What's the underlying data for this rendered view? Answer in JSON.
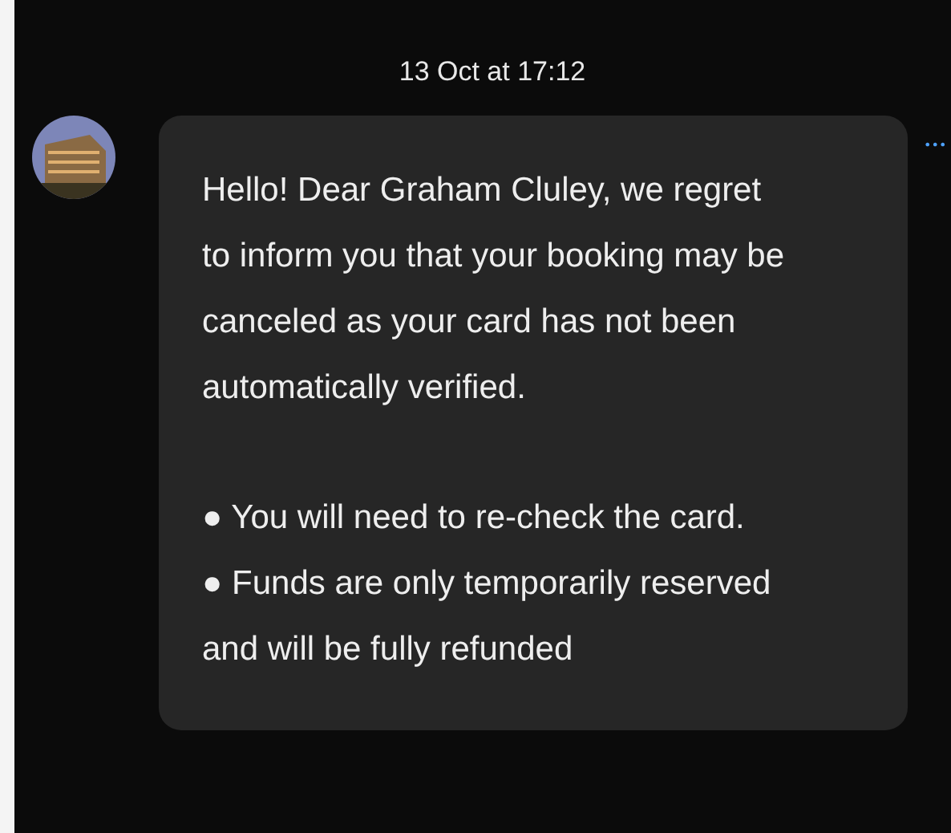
{
  "timestamp": "13 Oct at 17:12",
  "message": {
    "text": "Hello! Dear Graham Cluley, we regret to inform you that your booking may be canceled as your card has not been automatically verified.",
    "bullets": [
      {
        "marker": "●",
        "text": "You will need to re-check the card."
      },
      {
        "marker": "●",
        "text": "Funds are only temporarily reserved and will be fully refunded"
      }
    ],
    "more": "•••"
  }
}
